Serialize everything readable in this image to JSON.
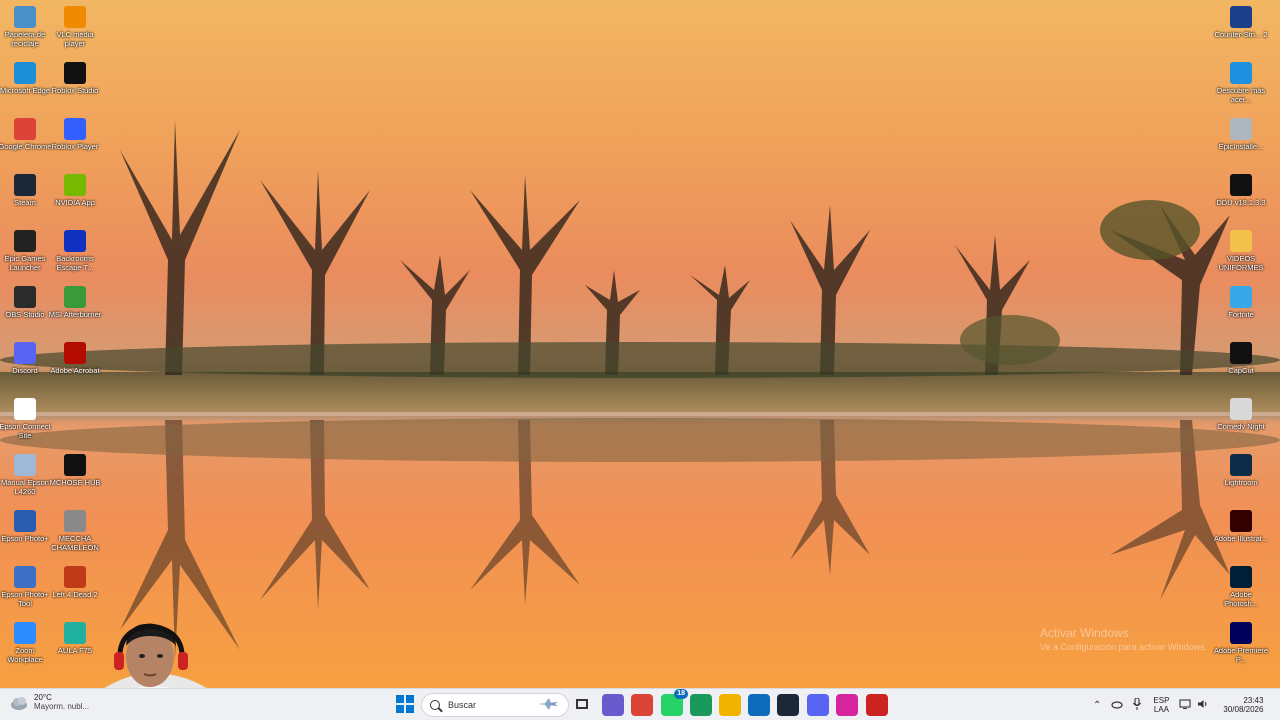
{
  "desktop": {
    "left_column_1": [
      {
        "label": "Papelera de reciclaje",
        "icon": "recycle-bin-icon",
        "color": "#4a90c8"
      },
      {
        "label": "Microsoft Edge",
        "icon": "edge-icon",
        "color": "#1d8fd6"
      },
      {
        "label": "Google Chrome",
        "icon": "chrome-icon",
        "color": "#db4437"
      },
      {
        "label": "Steam",
        "icon": "steam-icon",
        "color": "#1b2838"
      },
      {
        "label": "Epic Games Launcher",
        "icon": "epic-games-icon",
        "color": "#222222"
      },
      {
        "label": "OBS Studio",
        "icon": "obs-icon",
        "color": "#2b2b2b"
      },
      {
        "label": "Discord",
        "icon": "discord-icon",
        "color": "#5865f2"
      },
      {
        "label": "Epson Connect Site",
        "icon": "epson-connect-icon",
        "color": "#ffffff"
      },
      {
        "label": "Manual Epson L4260",
        "icon": "epson-manual-icon",
        "color": "#9fb8d6"
      },
      {
        "label": "Epson Photo+",
        "icon": "epson-photo-icon",
        "color": "#2a5db0"
      },
      {
        "label": "Epson Photo+ Tool",
        "icon": "epson-photo-tool-icon",
        "color": "#3d6fc4"
      },
      {
        "label": "Zoom Workplace",
        "icon": "zoom-icon",
        "color": "#2d8cff"
      }
    ],
    "left_column_2": [
      {
        "label": "VLC media player",
        "icon": "vlc-icon",
        "color": "#f08a00"
      },
      {
        "label": "Roblox Studio",
        "icon": "roblox-studio-icon",
        "color": "#111111"
      },
      {
        "label": "Roblox Player",
        "icon": "roblox-player-icon",
        "color": "#335fff"
      },
      {
        "label": "NVIDIA App",
        "icon": "nvidia-icon",
        "color": "#76b900"
      },
      {
        "label": "Backrooms Escape T...",
        "icon": "backrooms-icon",
        "color": "#1030c0"
      },
      {
        "label": "MSI Afterburner",
        "icon": "msi-afterburner-icon",
        "color": "#3a9a3a"
      },
      {
        "label": "Adobe Acrobat",
        "icon": "acrobat-icon",
        "color": "#b30b00"
      },
      {
        "label": "",
        "icon": "",
        "color": ""
      },
      {
        "label": "MCHOSE HUB",
        "icon": "mchose-icon",
        "color": "#111111"
      },
      {
        "label": "MECCHA CHAMELEON",
        "icon": "meccha-icon",
        "color": "#8a8a8a"
      },
      {
        "label": "Left 4 Dead 2",
        "icon": "left4dead-icon",
        "color": "#c03a1a"
      },
      {
        "label": "AULA F75",
        "icon": "aula-icon",
        "color": "#20b0a0"
      }
    ],
    "right_column": [
      {
        "label": "Counter-Stri... 2",
        "icon": "counter-strike-icon",
        "color": "#1c3f8a"
      },
      {
        "label": "Descubre más acer...",
        "icon": "discover-icon",
        "color": "#1e90e0"
      },
      {
        "label": "EpicInstalle...",
        "icon": "epic-installer-icon",
        "color": "#aeb6c0"
      },
      {
        "label": "DDU v18.1.3.3",
        "icon": "7zip-icon",
        "color": "#111111"
      },
      {
        "label": "VIDEOS UNIFORMES",
        "icon": "folder-icon",
        "color": "#f0c24a"
      },
      {
        "label": "Fortnite",
        "icon": "fortnite-icon",
        "color": "#38a8e8"
      },
      {
        "label": "CapCut",
        "icon": "capcut-icon",
        "color": "#111111"
      },
      {
        "label": "Comedy Night",
        "icon": "comedy-night-icon",
        "color": "#d8d8d8"
      },
      {
        "label": "Lightroom",
        "icon": "lightroom-icon",
        "color": "#0c2c48"
      },
      {
        "label": "Adobe Illustrat...",
        "icon": "illustrator-icon",
        "color": "#330000"
      },
      {
        "label": "Adobe Photosh...",
        "icon": "photoshop-icon",
        "color": "#001e36"
      },
      {
        "label": "Adobe Premiere P...",
        "icon": "premiere-icon",
        "color": "#00005b"
      }
    ]
  },
  "watermark": {
    "line1": "Activar Windows",
    "line2": "Ve a Configuración para activar Windows."
  },
  "taskbar": {
    "weather": {
      "temp": "20°C",
      "condition": "Mayorm. nubl..."
    },
    "search_placeholder": "Buscar",
    "pinned": [
      {
        "name": "start-button",
        "icon": "windows-icon",
        "color": "#0078d4"
      },
      {
        "name": "taskbar-airplane",
        "icon": "airplane-icon",
        "color": "#7a9cc0"
      },
      {
        "name": "taskbar-taskview",
        "icon": "task-view-icon",
        "color": "#333333"
      },
      {
        "name": "taskbar-store",
        "icon": "store-icon",
        "color": "#6a5acd"
      },
      {
        "name": "taskbar-chrome",
        "icon": "chrome-icon",
        "color": "#db4437"
      },
      {
        "name": "taskbar-whatsapp",
        "icon": "whatsapp-icon",
        "color": "#25d366",
        "badge": "18"
      },
      {
        "name": "taskbar-chrome-profile",
        "icon": "chrome-icon",
        "color": "#1a9a5a"
      },
      {
        "name": "taskbar-explorer",
        "icon": "folder-icon",
        "color": "#f0b400"
      },
      {
        "name": "taskbar-outlook",
        "icon": "outlook-icon",
        "color": "#0f6cbd"
      },
      {
        "name": "taskbar-steam",
        "icon": "steam-icon",
        "color": "#1b2838"
      },
      {
        "name": "taskbar-discord",
        "icon": "discord-icon",
        "color": "#5865f2"
      },
      {
        "name": "taskbar-instagram",
        "icon": "instagram-icon",
        "color": "#d6249f"
      },
      {
        "name": "taskbar-app",
        "icon": "app-icon",
        "color": "#cc2222"
      }
    ],
    "tray": {
      "language": "ESP",
      "layout": "LAA",
      "time": "23:43",
      "date": "30/08/2026"
    }
  }
}
